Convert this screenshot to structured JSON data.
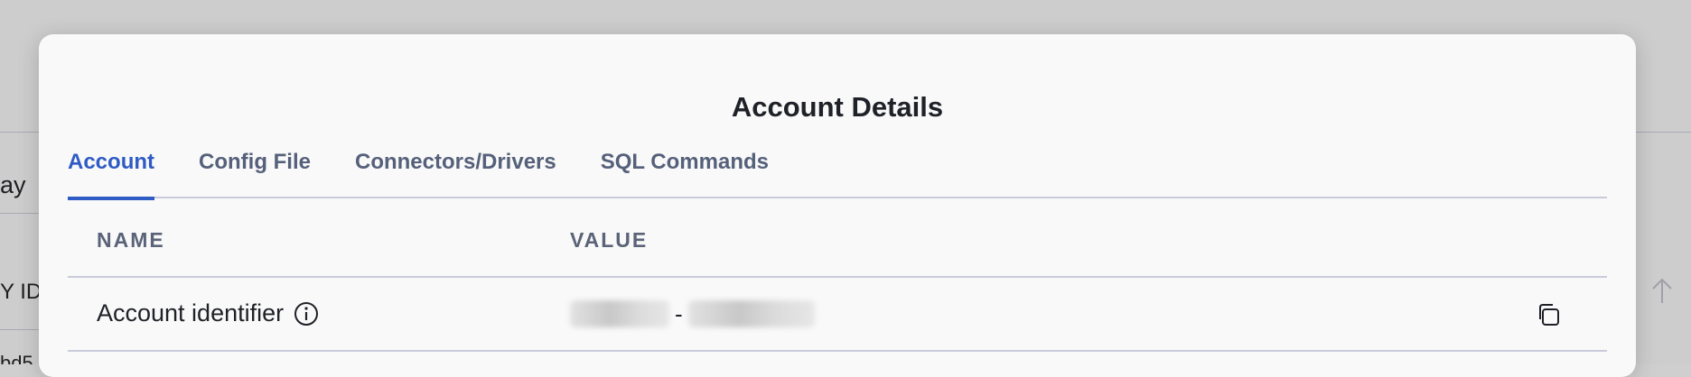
{
  "background": {
    "fragment_1": "ay",
    "fragment_2": "Y ID",
    "fragment_3": "bd5"
  },
  "modal": {
    "title": "Account Details",
    "tabs": [
      {
        "label": "Account",
        "active": true
      },
      {
        "label": "Config File",
        "active": false
      },
      {
        "label": "Connectors/Drivers",
        "active": false
      },
      {
        "label": "SQL Commands",
        "active": false
      }
    ],
    "table": {
      "headers": {
        "name": "NAME",
        "value": "VALUE"
      },
      "rows": [
        {
          "name": "Account identifier",
          "value_separator": "-"
        }
      ]
    }
  },
  "icons": {
    "info": "info-circle-icon",
    "copy": "copy-icon",
    "scroll_up": "arrow-up-icon"
  },
  "colors": {
    "accent": "#2e5bc4",
    "tab_inactive": "#55607a",
    "divider": "#c9cbdc",
    "modal_bg": "#f9f9f9",
    "overlay": "#cdcdcd"
  }
}
